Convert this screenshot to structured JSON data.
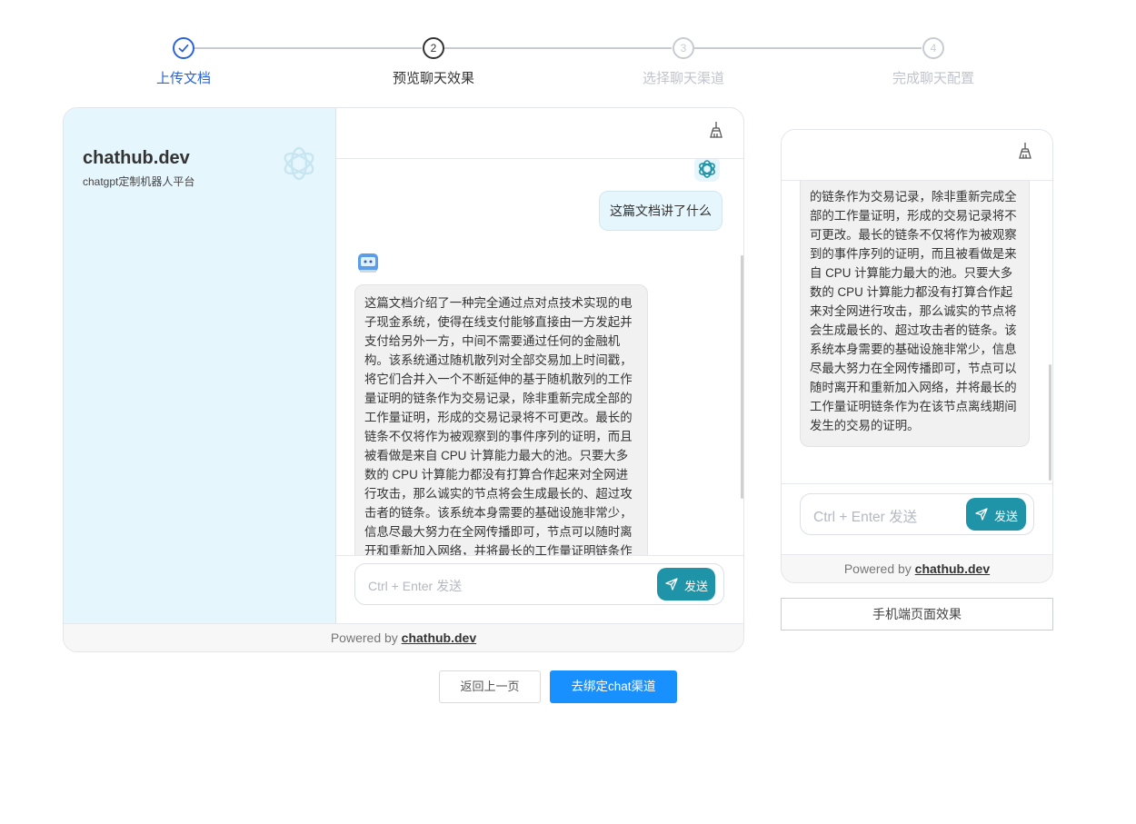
{
  "steps": [
    {
      "num": "✓",
      "label": "上传文档",
      "state": "done"
    },
    {
      "num": "2",
      "label": "预览聊天效果",
      "state": "active"
    },
    {
      "num": "3",
      "label": "选择聊天渠道",
      "state": "pending"
    },
    {
      "num": "4",
      "label": "完成聊天配置",
      "state": "pending"
    }
  ],
  "desktop": {
    "brand_title": "chathub.dev",
    "brand_subtitle": "chatgpt定制机器人平台",
    "user_message": "这篇文档讲了什么",
    "bot_message": "这篇文档介绍了一种完全通过点对点技术实现的电子现金系统，使得在线支付能够直接由一方发起并支付给另外一方，中间不需要通过任何的金融机构。该系统通过随机散列对全部交易加上时间戳，将它们合并入一个不断延伸的基于随机散列的工作量证明的链条作为交易记录，除非重新完成全部的工作量证明，形成的交易记录将不可更改。最长的链条不仅将作为被观察到的事件序列的证明，而且被看做是来自 CPU 计算能力最大的池。只要大多数的 CPU 计算能力都没有打算合作起来对全网进行攻击，那么诚实的节点将会生成最长的、超过攻击者的链条。该系统本身需要的基础设施非常少，信息尽最大努力在全网传播即可，节点可以随时离开和重新加入网络，并将最长的工作量证明链条作为在该节点离线期间发生的交易的证明。",
    "input_placeholder": "Ctrl + Enter 发送",
    "send_label": "发送",
    "powered_prefix": "Powered by ",
    "powered_link": "chathub.dev"
  },
  "mobile": {
    "bot_message": "的链条作为交易记录，除非重新完成全部的工作量证明，形成的交易记录将不可更改。最长的链条不仅将作为被观察到的事件序列的证明，而且被看做是来自 CPU 计算能力最大的池。只要大多数的 CPU 计算能力都没有打算合作起来对全网进行攻击，那么诚实的节点将会生成最长的、超过攻击者的链条。该系统本身需要的基础设施非常少，信息尽最大努力在全网传播即可，节点可以随时离开和重新加入网络，并将最长的工作量证明链条作为在该节点离线期间发生的交易的证明。",
    "input_placeholder": "Ctrl + Enter 发送",
    "send_label": "发送",
    "powered_prefix": "Powered by ",
    "powered_link": "chathub.dev"
  },
  "mobile_effect_label": "手机端页面效果",
  "buttons": {
    "back": "返回上一页",
    "next": "去绑定chat渠道"
  },
  "colors": {
    "accent": "#1890ff",
    "send": "#1f93a8",
    "sidebar": "#e6f6fd",
    "step_done": "#2b63d9"
  }
}
